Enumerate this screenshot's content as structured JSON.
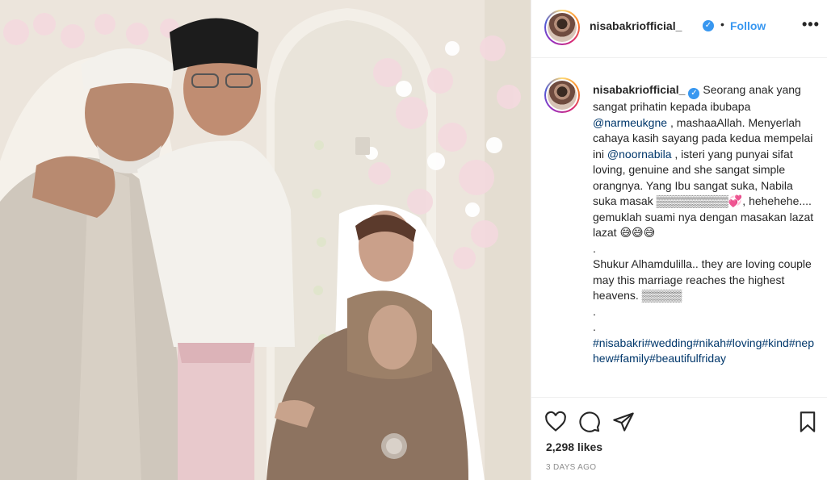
{
  "post": {
    "username": "nisabakriofficial_",
    "verified_mark": "✓",
    "separator": "•",
    "follow_label": "Follow",
    "more_label": "•••",
    "caption_lines": [
      "Seorang anak yang sangat prihatin kepada ibubapa",
      "@narmeukgne",
      ", mashaaAllah.",
      "Menyerlah cahaya kasih sayang pada kedua mempelai ini",
      "@noornabila",
      ", isteri yang punyai sifat loving, genuine and she sangat simple orangnya. Yang Ibu sangat suka, Nabila suka masak",
      "▒▒▒▒▒▒▒▒▒💞, hehehehe.... gemuklah suami nya dengan masakan lazat lazat 😅😅😅",
      ".",
      "Shukur Alhamdulilla.. they are loving couple may this marriage reaches the highest heavens. ▒▒▒▒▒",
      ".",
      ".",
      "#nisabakri#wedding#nikah#loving#kind#nephew#family#beautifulfriday"
    ],
    "likes": "2,298 likes",
    "date": "3 DAYS AGO"
  },
  "icons": {
    "like": "heart-icon",
    "comment": "comment-icon",
    "share": "paper-plane-icon",
    "save": "bookmark-icon",
    "verified": "verified-badge-icon"
  },
  "colors": {
    "link": "#00376b",
    "follow": "#3897f0",
    "verified": "#3897f0",
    "meta": "#8e8e8e",
    "border": "#efefef"
  }
}
